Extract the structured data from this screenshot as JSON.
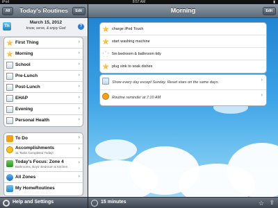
{
  "status_bar": {
    "carrier": "iPod",
    "time": "8:57 AM"
  },
  "left_panel": {
    "nav": {
      "all_button": "All",
      "title": "Today's Routines",
      "edit_button": "Edit"
    },
    "date_header": {
      "icon_letter": "Th",
      "date": "March 15, 2012",
      "motto": "know, serve, & enjoy God"
    },
    "routines": [
      {
        "label": "First Thing",
        "icon": "star-icon"
      },
      {
        "label": "Morning",
        "icon": "star-icon"
      },
      {
        "label": "School",
        "icon": "document-icon"
      },
      {
        "label": "Pre-Lunch",
        "icon": "document-icon"
      },
      {
        "label": "Post-Lunch",
        "icon": "document-icon"
      },
      {
        "label": "EHAP",
        "icon": "document-icon"
      },
      {
        "label": "Evening",
        "icon": "document-icon"
      },
      {
        "label": "Personal Health",
        "icon": "document-icon"
      }
    ],
    "extras": {
      "todo": {
        "label": "To Do"
      },
      "accomplishments": {
        "label": "Accomplishments",
        "sub": "11 Tasks Completed Today!"
      },
      "focus": {
        "label": "Today's Focus: Zone 4",
        "sub": "Bathrooms, Boys' Bedroom & Kitchen"
      },
      "zones": {
        "label": "All Zones"
      },
      "home_routines": {
        "label": "My HomeRoutines"
      }
    },
    "bottom": {
      "label": "Help and Settings"
    }
  },
  "right_panel": {
    "nav": {
      "title": "Morning",
      "edit_button": "Edit"
    },
    "tasks": [
      {
        "label": "charge iPod Touch",
        "done": true
      },
      {
        "label": "start washing machine",
        "done": true
      },
      {
        "label": "5m bedroom & bathroom tidy",
        "done": false
      },
      {
        "label": "plug sink to soak dishes",
        "done": true
      }
    ],
    "info": {
      "schedule": "Show every day except Sunday. Reset stars on the same days.",
      "reminder": "Routine reminder at 7:10 AM"
    },
    "bottom": {
      "label": "15 minutes"
    }
  },
  "colors": {
    "nav_bar": "#6b7785",
    "sky_top": "#1e80cf",
    "sky_bottom": "#a9dcf7",
    "star": "#f09010"
  }
}
